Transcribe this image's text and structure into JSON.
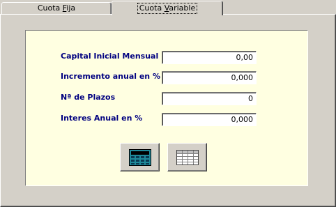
{
  "tabs": [
    {
      "label_pre": "Cuota ",
      "label_mn": "F",
      "label_post": "ija",
      "active": false
    },
    {
      "label_pre": "Cuota ",
      "label_mn": "V",
      "label_post": "ariable",
      "active": true
    }
  ],
  "form": {
    "fields": [
      {
        "label": "Capital Inicial Mensual",
        "value": "0,00"
      },
      {
        "label": "Incremento anual en %",
        "value": "0,000"
      },
      {
        "label": "Nª de Plazos",
        "value": "0"
      },
      {
        "label": "Interes Anual en %",
        "value": "0,000"
      }
    ]
  },
  "buttons": [
    {
      "icon": "calculator-icon"
    },
    {
      "icon": "table-icon"
    }
  ],
  "colors": {
    "background": "#d4d0c8",
    "panel": "#ffffe1",
    "label_text": "#000080",
    "calculator_body": "#1f8a9a"
  }
}
